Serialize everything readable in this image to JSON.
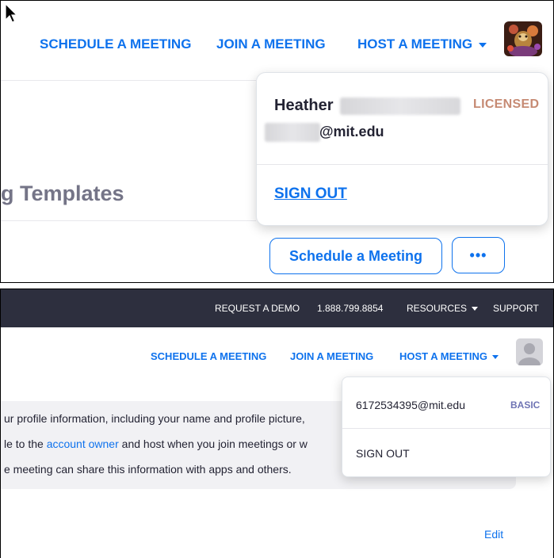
{
  "panel1": {
    "nav": {
      "schedule": "SCHEDULE A MEETING",
      "join": "JOIN A MEETING",
      "host": "HOST A MEETING"
    },
    "heading": "g Templates",
    "dropdown": {
      "first_name": "Heather",
      "email_suffix": "@mit.edu",
      "license": "LICENSED",
      "sign_out": "SIGN OUT"
    },
    "buttons": {
      "schedule": "Schedule a Meeting",
      "more": "•••"
    }
  },
  "panel2": {
    "topbar": {
      "demo": "REQUEST A DEMO",
      "phone": "1.888.799.8854",
      "resources": "RESOURCES",
      "support": "SUPPORT"
    },
    "nav": {
      "schedule": "SCHEDULE A MEETING",
      "join": "JOIN A MEETING",
      "host": "HOST A MEETING"
    },
    "info": {
      "line1": "ur profile information, including your name and profile picture,",
      "line2_pre": "le to the ",
      "line2_link": "account owner",
      "line2_post": " and host when you join meetings or w",
      "line3": "e meeting can share this information with apps and others."
    },
    "dropdown": {
      "email": "6172534395@mit.edu",
      "plan": "BASIC",
      "sign_out": "SIGN OUT"
    },
    "edit": "Edit"
  },
  "colors": {
    "brand_blue": "#0e72ed",
    "topbar": "#2d2f3e",
    "licensed": "#c68a73",
    "basic": "#6f74b4"
  }
}
